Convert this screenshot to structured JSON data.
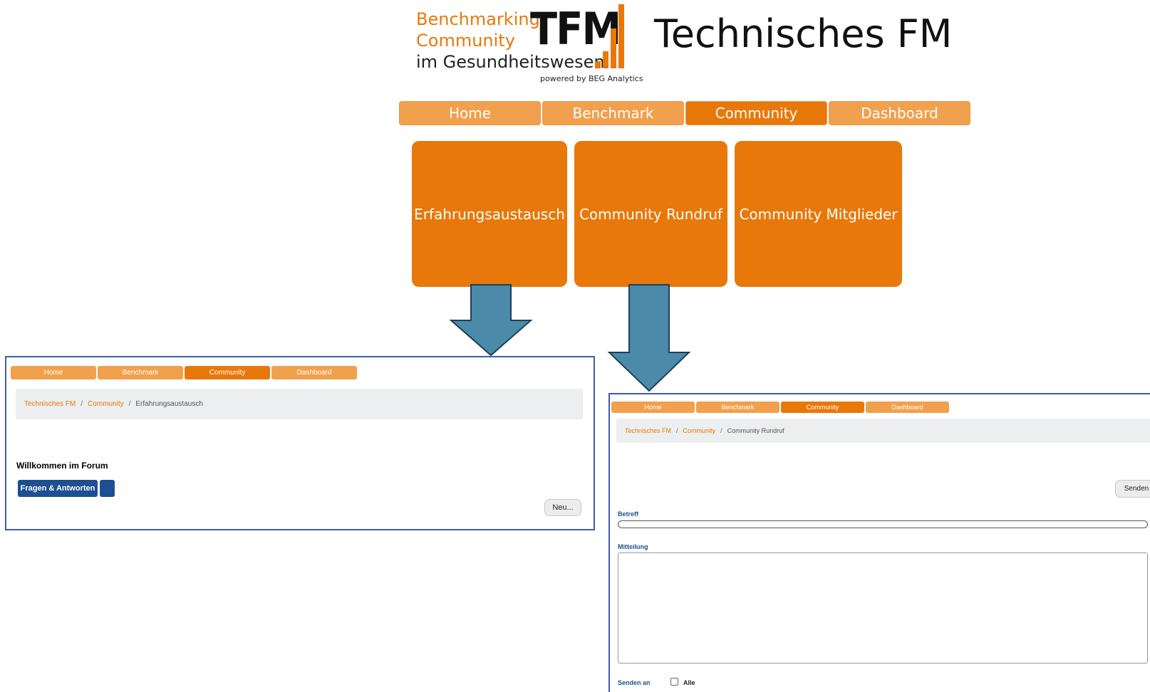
{
  "logo": {
    "line1": "Benchmarking",
    "line2": "Community",
    "line3": "im Gesundheitswesen",
    "mark": "TFM",
    "powered": "powered by BEG Analytics",
    "accent": "#e8780a"
  },
  "site_title": "Technisches FM",
  "main_nav": [
    {
      "label": "Home",
      "active": false
    },
    {
      "label": "Benchmark",
      "active": false
    },
    {
      "label": "Community",
      "active": true
    },
    {
      "label": "Dashboard",
      "active": false
    }
  ],
  "tiles": [
    {
      "label": "Erfahrungsaustausch"
    },
    {
      "label": "Community Rundruf"
    },
    {
      "label": "Community Mitglieder"
    }
  ],
  "arrow_color": "#4b8aa8",
  "forum_screen": {
    "nav": [
      "Home",
      "Benchmark",
      "Community",
      "Dashboard"
    ],
    "breadcrumb": [
      "Technisches FM",
      "Community",
      "Erfahrungsaustausch"
    ],
    "heading": "Willkommen im Forum",
    "tab_button": "Fragen & Antworten",
    "new_button": "Neu..."
  },
  "rundruf_screen": {
    "nav": [
      "Home",
      "Benchmark",
      "Community",
      "Dashboard"
    ],
    "breadcrumb": [
      "Technisches FM",
      "Community",
      "Community Rundruf"
    ],
    "send_button": "Senden",
    "subject_label": "Betreff",
    "message_label": "Mitteilung",
    "send_to_label": "Senden an",
    "all_label": "Alle"
  },
  "colors": {
    "orange": "#e8780a",
    "orange_light": "#f1a04d",
    "blue_button": "#1d4f91",
    "panel_border": "#3b5fae"
  }
}
